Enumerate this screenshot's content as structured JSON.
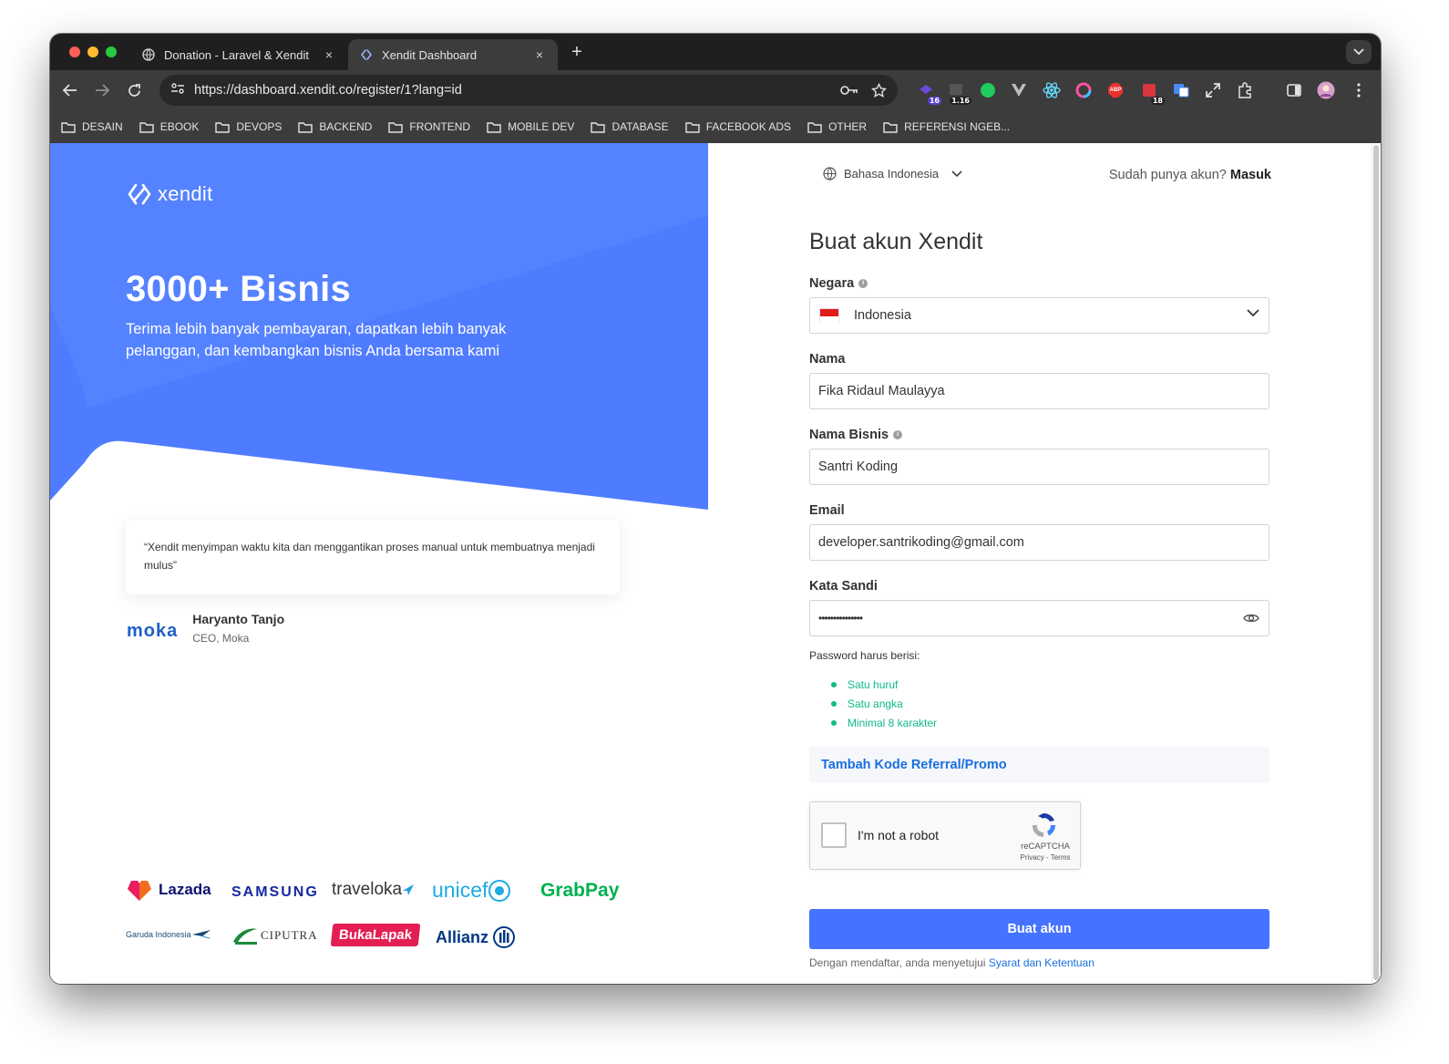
{
  "browser": {
    "tabs": [
      {
        "title": "Donation - Laravel & Xendit",
        "close": "×"
      },
      {
        "title": "Xendit Dashboard",
        "close": "×"
      }
    ],
    "new_tab": "+",
    "url": "https://dashboard.xendit.co/register/1?lang=id",
    "extension_badges": {
      "ext1": "16",
      "ext2": "1.16",
      "abp": "ABP",
      "ext_cal": "18"
    },
    "bookmarks": [
      "DESAIN",
      "EBOOK",
      "DEVOPS",
      "BACKEND",
      "FRONTEND",
      "MOBILE DEV",
      "DATABASE",
      "FACEBOOK ADS",
      "OTHER",
      "REFERENSI NGEB..."
    ]
  },
  "left_panel": {
    "logo_text": "xendit",
    "hero_title": "3000+ Bisnis",
    "hero_subtitle": "Terima lebih banyak pembayaran, dapatkan lebih banyak pelanggan, dan kembangkan bisnis Anda bersama kami",
    "quote": "“Xendit menyimpan waktu kita dan menggantikan proses manual untuk membuatnya menjadi mulus”",
    "testimonial": {
      "company_logo": "moka",
      "name": "Haryanto Tanjo",
      "role": "CEO, Moka"
    },
    "brands": [
      "Lazada",
      "SAMSUNG",
      "traveloka",
      "unicef",
      "GrabPay",
      "Garuda Indonesia",
      "CIPUTRA",
      "BukaLapak",
      "Allianz"
    ],
    "brand_color": "#4f7cff"
  },
  "right_panel": {
    "language": "Bahasa Indonesia",
    "login_prompt": "Sudah punya akun?",
    "login_link": "Masuk",
    "title": "Buat akun Xendit",
    "fields": {
      "country": {
        "label": "Negara",
        "value": "Indonesia"
      },
      "name": {
        "label": "Nama",
        "value": "Fika Ridaul Maulayya"
      },
      "business": {
        "label": "Nama Bisnis",
        "value": "Santri Koding"
      },
      "email": {
        "label": "Email",
        "value": "developer.santrikoding@gmail.com"
      },
      "password": {
        "label": "Kata Sandi",
        "value": "•••••••••••••••"
      }
    },
    "password_hint": "Password harus berisi:",
    "password_rules": [
      "Satu huruf",
      "Satu angka",
      "Minimal 8 karakter"
    ],
    "referral": "Tambah Kode Referral/Promo",
    "captcha": {
      "label": "I'm not a robot",
      "brand": "reCAPTCHA",
      "links": "Privacy - Terms"
    },
    "submit": "Buat akun",
    "terms_prefix": "Dengan mendaftar, anda menyetujui",
    "terms_link": "Syarat dan Ketentuan",
    "accent_color": "#4573ff",
    "success_color": "#10b98a"
  }
}
